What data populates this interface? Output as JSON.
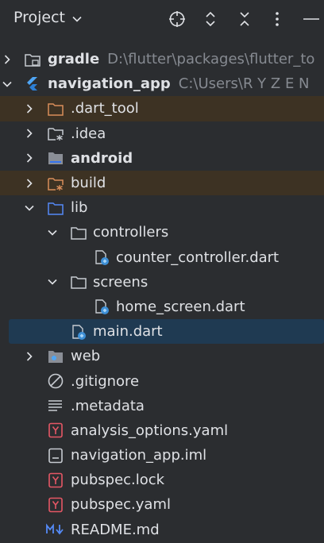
{
  "header": {
    "title": "Project",
    "icons": [
      "crosshair-icon",
      "expand-collapse-icon",
      "collapse-all-icon",
      "more-icon",
      "minimize-icon"
    ]
  },
  "tree": {
    "gradle": {
      "label": "gradle",
      "path": "D:\\flutter\\packages\\flutter_to"
    },
    "navigation_app": {
      "label": "navigation_app",
      "path": "C:\\Users\\R Y Z E N"
    },
    "dart_tool": {
      "label": ".dart_tool"
    },
    "idea": {
      "label": ".idea"
    },
    "android": {
      "label": "android"
    },
    "build": {
      "label": "build"
    },
    "lib": {
      "label": "lib"
    },
    "controllers": {
      "label": "controllers"
    },
    "counter_controller": {
      "label": "counter_controller.dart"
    },
    "screens": {
      "label": "screens"
    },
    "home_screen": {
      "label": "home_screen.dart"
    },
    "main": {
      "label": "main.dart"
    },
    "web": {
      "label": "web"
    },
    "gitignore": {
      "label": ".gitignore"
    },
    "metadata": {
      "label": ".metadata"
    },
    "analysis_options": {
      "label": "analysis_options.yaml"
    },
    "navigation_iml": {
      "label": "navigation_app.iml"
    },
    "pubspec_lock": {
      "label": "pubspec.lock"
    },
    "pubspec_yaml": {
      "label": "pubspec.yaml"
    },
    "readme": {
      "label": "README.md"
    }
  },
  "colors": {
    "background": "#2b2d30",
    "excluded_row": "#3d3223",
    "selected_row": "#1f3a52",
    "folder": "#c7cbd1",
    "excluded_folder": "#d98e5b",
    "source_folder": "#548af7",
    "yaml_red": "#e55765",
    "markdown_blue": "#548af7",
    "flutter_blue": "#4fa6f5"
  }
}
